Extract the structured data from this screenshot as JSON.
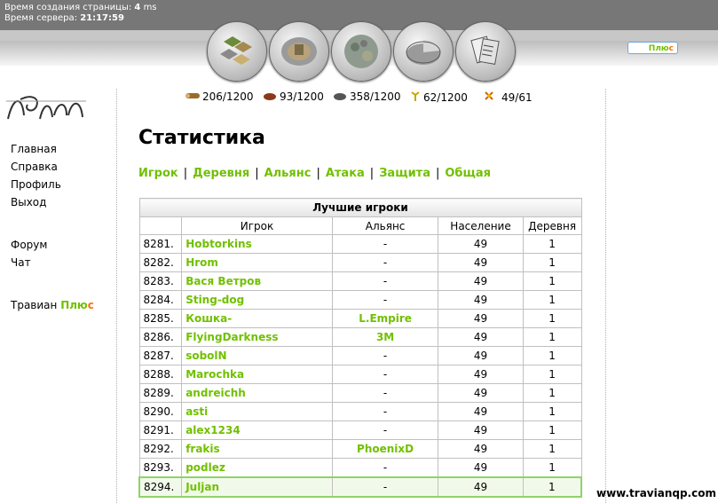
{
  "header": {
    "gen_label": "Время создания страницы:",
    "gen_value": "4",
    "gen_unit": "ms",
    "server_label": "Время сервера:",
    "server_time": "21:17:59",
    "plus_label_1": "Плю",
    "plus_label_2": "с"
  },
  "menu": {
    "home": "Главная",
    "help": "Справка",
    "profile": "Профиль",
    "logout": "Выход",
    "forum": "Форум",
    "chat": "Чат",
    "travian": "Травиан",
    "plus_1": "Плю",
    "plus_2": "с"
  },
  "resources": {
    "wood": "206/1200",
    "clay": "93/1200",
    "iron": "358/1200",
    "crop": "62/1200",
    "consumption": "49/61"
  },
  "page": {
    "title": "Статистика",
    "tabs": [
      "Игрок",
      "Деревня",
      "Альянс",
      "Атака",
      "Защита",
      "Общая"
    ]
  },
  "table": {
    "caption": "Лучшие игроки",
    "headers": [
      "",
      "Игрок",
      "Альянс",
      "Население",
      "Деревня"
    ],
    "rows": [
      {
        "rank": "8281.",
        "player": "Hobtorkins",
        "alliance": "-",
        "pop": "49",
        "villages": "1"
      },
      {
        "rank": "8282.",
        "player": "Hrom",
        "alliance": "-",
        "pop": "49",
        "villages": "1"
      },
      {
        "rank": "8283.",
        "player": "Вася Ветров",
        "alliance": "-",
        "pop": "49",
        "villages": "1"
      },
      {
        "rank": "8284.",
        "player": "Sting-dog",
        "alliance": "-",
        "pop": "49",
        "villages": "1"
      },
      {
        "rank": "8285.",
        "player": "Кошка-",
        "alliance": "L.Empire",
        "pop": "49",
        "villages": "1"
      },
      {
        "rank": "8286.",
        "player": "FlyingDarkness",
        "alliance": "3M",
        "pop": "49",
        "villages": "1"
      },
      {
        "rank": "8287.",
        "player": "sobolN",
        "alliance": "-",
        "pop": "49",
        "villages": "1"
      },
      {
        "rank": "8288.",
        "player": "Marochka",
        "alliance": "-",
        "pop": "49",
        "villages": "1"
      },
      {
        "rank": "8289.",
        "player": "andreichh",
        "alliance": "-",
        "pop": "49",
        "villages": "1"
      },
      {
        "rank": "8290.",
        "player": "asti",
        "alliance": "-",
        "pop": "49",
        "villages": "1"
      },
      {
        "rank": "8291.",
        "player": "alex1234",
        "alliance": "-",
        "pop": "49",
        "villages": "1"
      },
      {
        "rank": "8292.",
        "player": "frakis",
        "alliance": "PhoenixD",
        "pop": "49",
        "villages": "1"
      },
      {
        "rank": "8293.",
        "player": "podlez",
        "alliance": "-",
        "pop": "49",
        "villages": "1"
      },
      {
        "rank": "8294.",
        "player": "Juljan",
        "alliance": "-",
        "pop": "49",
        "villages": "1"
      }
    ]
  },
  "watermark": "www.travianqp.com",
  "colors": {
    "link_green": "#71c000",
    "plus_orange": "#ff6f0f",
    "header_dark": "#777777"
  }
}
